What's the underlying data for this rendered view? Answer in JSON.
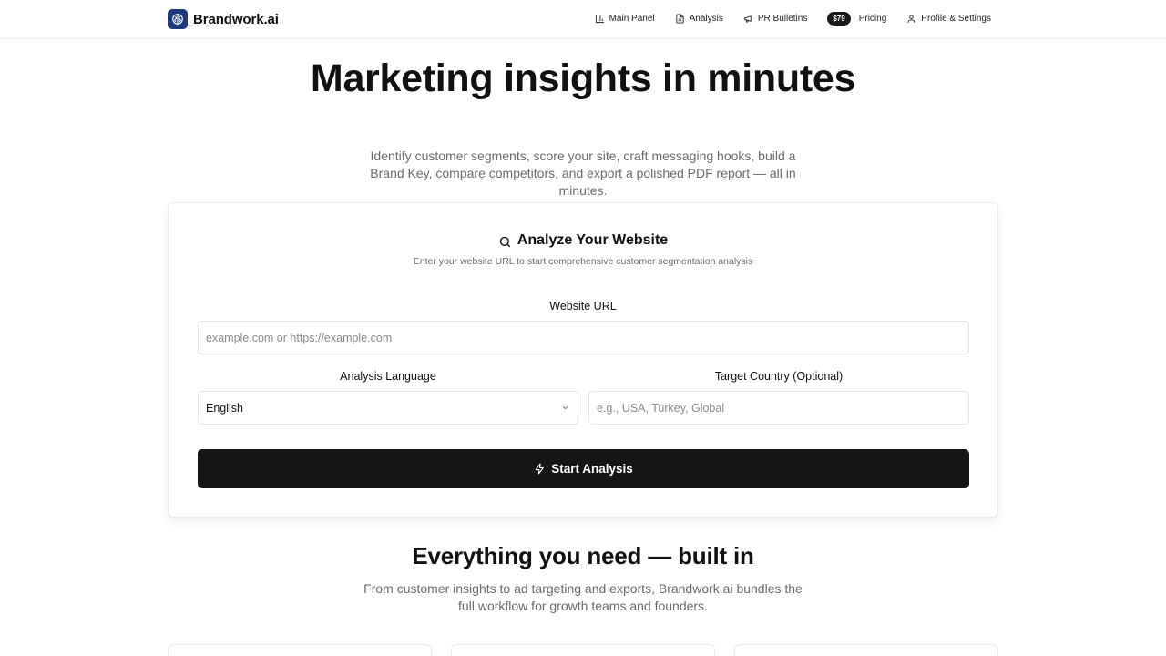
{
  "header": {
    "brand_name": "Brandwork.ai",
    "nav": {
      "main_panel": "Main Panel",
      "analysis": "Analysis",
      "pr_bulletins": "PR Bulletins",
      "price_badge": "$79",
      "pricing": "Pricing",
      "profile": "Profile & Settings"
    }
  },
  "hero": {
    "title": "Marketing insights in minutes",
    "subtitle": "Identify customer segments, score your site, craft messaging hooks, build a Brand Key, compare competitors, and export a polished PDF report — all in minutes."
  },
  "analyze_card": {
    "title": "Analyze Your Website",
    "subtitle": "Enter your website URL to start comprehensive customer segmentation analysis",
    "url_label": "Website URL",
    "url_placeholder": "example.com or https://example.com",
    "language_label": "Analysis Language",
    "language_value": "English",
    "country_label": "Target Country (Optional)",
    "country_placeholder": "e.g., USA, Turkey, Global",
    "start_button": "Start Analysis"
  },
  "features": {
    "title": "Everything you need — built in",
    "subtitle": "From customer insights to ad targeting and exports, Brandwork.ai bundles the full workflow for growth teams and founders."
  },
  "icons": {
    "brand_logo": "brain-icon",
    "main_panel": "bar-chart-icon",
    "analysis": "document-icon",
    "pr_bulletins": "megaphone-icon",
    "profile": "user-icon",
    "analyze": "search-icon",
    "select": "chevron-down-icon",
    "start": "lightning-icon"
  },
  "colors": {
    "brand_logo_bg": "#1f3a7a",
    "primary_button": "#151515",
    "muted_text": "#6b6b6b"
  }
}
